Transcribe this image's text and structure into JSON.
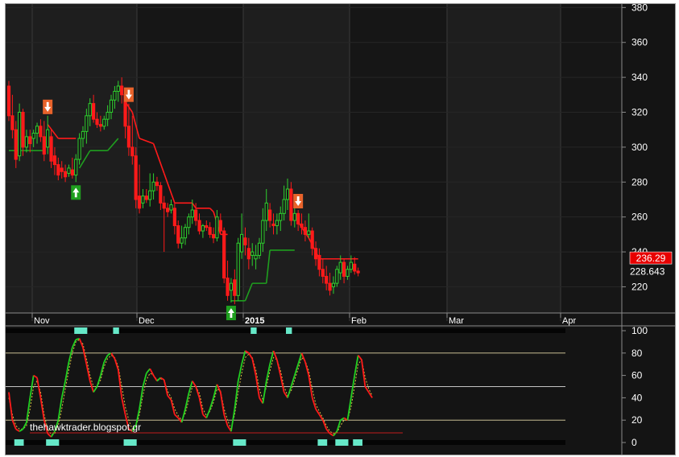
{
  "chart_data": [
    {
      "type": "candlestick",
      "x_labels": [
        "Nov",
        "Dec",
        "2015",
        "Feb",
        "Mar",
        "Apr"
      ],
      "y_ticks": [
        220,
        240,
        260,
        280,
        300,
        320,
        340,
        360,
        380
      ],
      "ylim": [
        205,
        382
      ],
      "last_price_badge": "236.29",
      "last_value_label": "228.643",
      "colors": {
        "up": "#2ed12e",
        "down": "#ff1a1a",
        "stop_up": "#1f9f1f",
        "stop_down": "#ff1a1a",
        "background": "#141414",
        "band": "#1e1e1e"
      },
      "candles": [
        {
          "o": 335,
          "h": 338,
          "l": 315,
          "c": 318
        },
        {
          "o": 318,
          "h": 330,
          "l": 305,
          "c": 310
        },
        {
          "o": 310,
          "h": 315,
          "l": 288,
          "c": 293
        },
        {
          "o": 295,
          "h": 325,
          "l": 292,
          "c": 320
        },
        {
          "o": 320,
          "h": 322,
          "l": 295,
          "c": 300
        },
        {
          "o": 300,
          "h": 310,
          "l": 297,
          "c": 306
        },
        {
          "o": 306,
          "h": 310,
          "l": 297,
          "c": 302
        },
        {
          "o": 305,
          "h": 310,
          "l": 300,
          "c": 308
        },
        {
          "o": 308,
          "h": 314,
          "l": 302,
          "c": 312
        },
        {
          "o": 312,
          "h": 316,
          "l": 303,
          "c": 306
        },
        {
          "o": 306,
          "h": 315,
          "l": 292,
          "c": 296
        },
        {
          "o": 300,
          "h": 318,
          "l": 296,
          "c": 310
        },
        {
          "o": 306,
          "h": 310,
          "l": 288,
          "c": 292
        },
        {
          "o": 295,
          "h": 300,
          "l": 284,
          "c": 290
        },
        {
          "o": 290,
          "h": 294,
          "l": 281,
          "c": 284
        },
        {
          "o": 288,
          "h": 292,
          "l": 282,
          "c": 286
        },
        {
          "o": 286,
          "h": 290,
          "l": 280,
          "c": 283
        },
        {
          "o": 285,
          "h": 290,
          "l": 283,
          "c": 288
        },
        {
          "o": 287,
          "h": 294,
          "l": 282,
          "c": 284
        },
        {
          "o": 284,
          "h": 296,
          "l": 280,
          "c": 293
        },
        {
          "o": 293,
          "h": 308,
          "l": 290,
          "c": 305
        },
        {
          "o": 305,
          "h": 312,
          "l": 300,
          "c": 309
        },
        {
          "o": 309,
          "h": 322,
          "l": 302,
          "c": 318
        },
        {
          "o": 318,
          "h": 328,
          "l": 312,
          "c": 325
        },
        {
          "o": 325,
          "h": 330,
          "l": 314,
          "c": 316
        },
        {
          "o": 316,
          "h": 320,
          "l": 311,
          "c": 313
        },
        {
          "o": 313,
          "h": 318,
          "l": 309,
          "c": 312
        },
        {
          "o": 312,
          "h": 318,
          "l": 310,
          "c": 316
        },
        {
          "o": 316,
          "h": 324,
          "l": 312,
          "c": 320
        },
        {
          "o": 320,
          "h": 330,
          "l": 316,
          "c": 327
        },
        {
          "o": 327,
          "h": 335,
          "l": 322,
          "c": 332
        },
        {
          "o": 332,
          "h": 338,
          "l": 326,
          "c": 335
        },
        {
          "o": 335,
          "h": 340,
          "l": 325,
          "c": 330
        },
        {
          "o": 330,
          "h": 333,
          "l": 305,
          "c": 312
        },
        {
          "o": 312,
          "h": 325,
          "l": 295,
          "c": 300
        },
        {
          "o": 300,
          "h": 318,
          "l": 290,
          "c": 295
        },
        {
          "o": 295,
          "h": 300,
          "l": 265,
          "c": 270
        },
        {
          "o": 272,
          "h": 290,
          "l": 262,
          "c": 265
        },
        {
          "o": 268,
          "h": 276,
          "l": 265,
          "c": 272
        },
        {
          "o": 272,
          "h": 276,
          "l": 268,
          "c": 270
        },
        {
          "o": 270,
          "h": 285,
          "l": 266,
          "c": 275
        },
        {
          "o": 275,
          "h": 285,
          "l": 270,
          "c": 280
        },
        {
          "o": 280,
          "h": 283,
          "l": 275,
          "c": 278
        },
        {
          "o": 278,
          "h": 280,
          "l": 264,
          "c": 268
        },
        {
          "o": 268,
          "h": 272,
          "l": 240,
          "c": 265
        },
        {
          "o": 265,
          "h": 268,
          "l": 260,
          "c": 263
        },
        {
          "o": 264,
          "h": 270,
          "l": 262,
          "c": 267
        },
        {
          "o": 265,
          "h": 268,
          "l": 250,
          "c": 255
        },
        {
          "o": 255,
          "h": 258,
          "l": 242,
          "c": 245
        },
        {
          "o": 245,
          "h": 255,
          "l": 242,
          "c": 248
        },
        {
          "o": 248,
          "h": 256,
          "l": 244,
          "c": 254
        },
        {
          "o": 254,
          "h": 262,
          "l": 250,
          "c": 260
        },
        {
          "o": 260,
          "h": 270,
          "l": 256,
          "c": 264
        },
        {
          "o": 264,
          "h": 268,
          "l": 255,
          "c": 258
        },
        {
          "o": 258,
          "h": 262,
          "l": 250,
          "c": 252
        },
        {
          "o": 252,
          "h": 256,
          "l": 248,
          "c": 255
        },
        {
          "o": 255,
          "h": 258,
          "l": 252,
          "c": 254
        },
        {
          "o": 254,
          "h": 257,
          "l": 248,
          "c": 250
        },
        {
          "o": 250,
          "h": 254,
          "l": 245,
          "c": 248
        },
        {
          "o": 248,
          "h": 264,
          "l": 246,
          "c": 260
        },
        {
          "o": 258,
          "h": 262,
          "l": 250,
          "c": 252
        },
        {
          "o": 252,
          "h": 254,
          "l": 222,
          "c": 225
        },
        {
          "o": 225,
          "h": 235,
          "l": 212,
          "c": 215
        },
        {
          "o": 218,
          "h": 225,
          "l": 211,
          "c": 222
        },
        {
          "o": 224,
          "h": 230,
          "l": 210,
          "c": 215
        },
        {
          "o": 215,
          "h": 248,
          "l": 212,
          "c": 245
        },
        {
          "o": 240,
          "h": 262,
          "l": 236,
          "c": 250
        },
        {
          "o": 248,
          "h": 254,
          "l": 238,
          "c": 244
        },
        {
          "o": 242,
          "h": 248,
          "l": 230,
          "c": 236
        },
        {
          "o": 238,
          "h": 245,
          "l": 232,
          "c": 240
        },
        {
          "o": 236,
          "h": 244,
          "l": 230,
          "c": 238
        },
        {
          "o": 238,
          "h": 248,
          "l": 236,
          "c": 245
        },
        {
          "o": 245,
          "h": 265,
          "l": 240,
          "c": 258
        },
        {
          "o": 258,
          "h": 276,
          "l": 252,
          "c": 268
        },
        {
          "o": 264,
          "h": 268,
          "l": 254,
          "c": 258
        },
        {
          "o": 256,
          "h": 262,
          "l": 250,
          "c": 255
        },
        {
          "o": 255,
          "h": 262,
          "l": 250,
          "c": 258
        },
        {
          "o": 258,
          "h": 266,
          "l": 252,
          "c": 262
        },
        {
          "o": 262,
          "h": 278,
          "l": 258,
          "c": 270
        },
        {
          "o": 270,
          "h": 282,
          "l": 264,
          "c": 276
        },
        {
          "o": 276,
          "h": 280,
          "l": 255,
          "c": 258
        },
        {
          "o": 258,
          "h": 265,
          "l": 254,
          "c": 262
        },
        {
          "o": 262,
          "h": 264,
          "l": 252,
          "c": 256
        },
        {
          "o": 256,
          "h": 262,
          "l": 250,
          "c": 254
        },
        {
          "o": 254,
          "h": 258,
          "l": 246,
          "c": 250
        },
        {
          "o": 250,
          "h": 262,
          "l": 248,
          "c": 252
        },
        {
          "o": 252,
          "h": 254,
          "l": 238,
          "c": 242
        },
        {
          "o": 242,
          "h": 246,
          "l": 232,
          "c": 236
        },
        {
          "o": 238,
          "h": 242,
          "l": 226,
          "c": 230
        },
        {
          "o": 230,
          "h": 236,
          "l": 222,
          "c": 226
        },
        {
          "o": 226,
          "h": 232,
          "l": 218,
          "c": 222
        },
        {
          "o": 222,
          "h": 228,
          "l": 215,
          "c": 218
        },
        {
          "o": 220,
          "h": 226,
          "l": 216,
          "c": 222
        },
        {
          "o": 222,
          "h": 232,
          "l": 220,
          "c": 230
        },
        {
          "o": 228,
          "h": 238,
          "l": 224,
          "c": 234
        },
        {
          "o": 234,
          "h": 236,
          "l": 222,
          "c": 226
        },
        {
          "o": 226,
          "h": 232,
          "l": 224,
          "c": 230
        },
        {
          "o": 230,
          "h": 238,
          "l": 228,
          "c": 234
        },
        {
          "o": 233,
          "h": 237,
          "l": 227,
          "c": 229
        },
        {
          "o": 229,
          "h": 231,
          "l": 226,
          "c": 228
        }
      ],
      "trailing_stop": [
        {
          "i": 0,
          "v": 298,
          "side": "long"
        },
        {
          "i": 10,
          "v": 298,
          "side": "long"
        },
        {
          "i": 11,
          "v": 313,
          "side": "short"
        },
        {
          "i": 14,
          "v": 305,
          "side": "short"
        },
        {
          "i": 19,
          "v": 305,
          "side": "short"
        },
        {
          "i": 20,
          "v": 288,
          "side": "long"
        },
        {
          "i": 23,
          "v": 298,
          "side": "long"
        },
        {
          "i": 28,
          "v": 298,
          "side": "long"
        },
        {
          "i": 31,
          "v": 305,
          "side": "long"
        },
        {
          "i": 33,
          "v": 326,
          "side": "short"
        },
        {
          "i": 35,
          "v": 320,
          "side": "short"
        },
        {
          "i": 37,
          "v": 305,
          "side": "short"
        },
        {
          "i": 41,
          "v": 302,
          "side": "short"
        },
        {
          "i": 44,
          "v": 285,
          "side": "short"
        },
        {
          "i": 47,
          "v": 268,
          "side": "short"
        },
        {
          "i": 52,
          "v": 268,
          "side": "short"
        },
        {
          "i": 53,
          "v": 265,
          "side": "short"
        },
        {
          "i": 57,
          "v": 265,
          "side": "short"
        },
        {
          "i": 58,
          "v": 263,
          "side": "short"
        },
        {
          "i": 60,
          "v": 250,
          "side": "short"
        },
        {
          "i": 62,
          "v": 250,
          "side": "short"
        },
        {
          "i": 63,
          "v": 212,
          "side": "long"
        },
        {
          "i": 67,
          "v": 212,
          "side": "long"
        },
        {
          "i": 69,
          "v": 222,
          "side": "long"
        },
        {
          "i": 73,
          "v": 222,
          "side": "long"
        },
        {
          "i": 74,
          "v": 241,
          "side": "long"
        },
        {
          "i": 81,
          "v": 241,
          "side": "long"
        },
        {
          "i": 82,
          "v": 257,
          "side": "short"
        },
        {
          "i": 85,
          "v": 248,
          "side": "short"
        },
        {
          "i": 88,
          "v": 236,
          "side": "short"
        },
        {
          "i": 99,
          "v": 236,
          "side": "short"
        }
      ],
      "signals": [
        {
          "i": 11,
          "type": "sell"
        },
        {
          "i": 19,
          "type": "buy"
        },
        {
          "i": 34,
          "type": "sell"
        },
        {
          "i": 63,
          "type": "buy"
        },
        {
          "i": 82,
          "type": "sell"
        }
      ]
    },
    {
      "type": "line",
      "y_ticks": [
        0,
        20,
        40,
        60,
        80,
        100
      ],
      "ylim": [
        0,
        100
      ],
      "levels": [
        20,
        50,
        80
      ],
      "watermark": "thehawktrader.blogspot.gr",
      "series": [
        {
          "values": [
            45,
            20,
            12,
            10,
            12,
            18,
            40,
            60,
            58,
            40,
            20,
            8,
            5,
            10,
            20,
            40,
            55,
            72,
            85,
            92,
            93,
            85,
            70,
            55,
            45,
            50,
            60,
            72,
            78,
            80,
            75,
            65,
            40,
            25,
            12,
            10,
            15,
            30,
            50,
            62,
            66,
            60,
            55,
            58,
            56,
            42,
            38,
            25,
            22,
            18,
            30,
            44,
            55,
            50,
            40,
            25,
            22,
            30,
            40,
            52,
            45,
            25,
            15,
            10,
            30,
            55,
            70,
            82,
            80,
            75,
            60,
            40,
            35,
            55,
            70,
            82,
            74,
            60,
            45,
            40,
            50,
            60,
            70,
            80,
            72,
            60,
            40,
            30,
            25,
            20,
            12,
            8,
            6,
            10,
            20,
            22,
            20,
            40,
            60,
            78,
            74,
            50,
            45,
            40
          ]
        },
        {
          "values": [
            40,
            25,
            15,
            12,
            12,
            15,
            30,
            50,
            55,
            45,
            25,
            12,
            7,
            8,
            15,
            30,
            48,
            65,
            80,
            90,
            92,
            88,
            75,
            60,
            50,
            50,
            56,
            68,
            75,
            78,
            76,
            68,
            50,
            32,
            20,
            12,
            14,
            25,
            42,
            56,
            62,
            60,
            56,
            57,
            56,
            46,
            40,
            30,
            24,
            20,
            26,
            38,
            50,
            50,
            44,
            30,
            24,
            28,
            36,
            48,
            46,
            30,
            20,
            12,
            25,
            45,
            62,
            76,
            79,
            76,
            65,
            48,
            38,
            50,
            64,
            76,
            74,
            64,
            50,
            42,
            46,
            56,
            66,
            76,
            73,
            64,
            48,
            34,
            28,
            22,
            15,
            10,
            8,
            9,
            15,
            20,
            20,
            32,
            50,
            70,
            74,
            58,
            48,
            42
          ]
        }
      ],
      "markers_top": [
        {
          "i": 19,
          "w": 3
        },
        {
          "i": 30,
          "w": 1
        },
        {
          "i": 69,
          "w": 1
        },
        {
          "i": 79,
          "w": 1
        }
      ],
      "markers_bottom": [
        {
          "i": 2,
          "w": 2
        },
        {
          "i": 11,
          "w": 3
        },
        {
          "i": 33,
          "w": 3
        },
        {
          "i": 64,
          "w": 3
        },
        {
          "i": 88,
          "w": 2
        },
        {
          "i": 93,
          "w": 3
        },
        {
          "i": 98,
          "w": 2
        }
      ]
    }
  ]
}
